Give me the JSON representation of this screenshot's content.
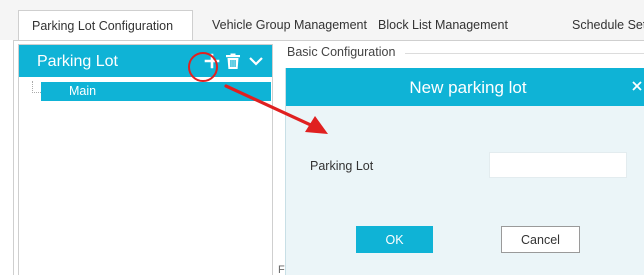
{
  "tabs": [
    "Parking Lot Configuration",
    "Vehicle Group Management",
    "Block List Management",
    "Schedule Settings"
  ],
  "left_panel": {
    "title": "Parking Lot",
    "toolbar_icons": [
      "plus-icon",
      "trash-icon",
      "chevron-down-icon"
    ],
    "tree": [
      "Main"
    ]
  },
  "basic_section": {
    "label": "Basic Configuration",
    "partial_text": "F"
  },
  "dialog": {
    "title": "New parking lot",
    "close_glyph": "×",
    "field_label": "Parking Lot",
    "field_value": "",
    "ok_label": "OK",
    "cancel_label": "Cancel"
  },
  "colors": {
    "accent": "#0fb3d6",
    "dialog_bg": "#ebf5f8",
    "annotation": "#e02020"
  },
  "annotations": [
    "red-circle-highlight",
    "red-arrow"
  ]
}
